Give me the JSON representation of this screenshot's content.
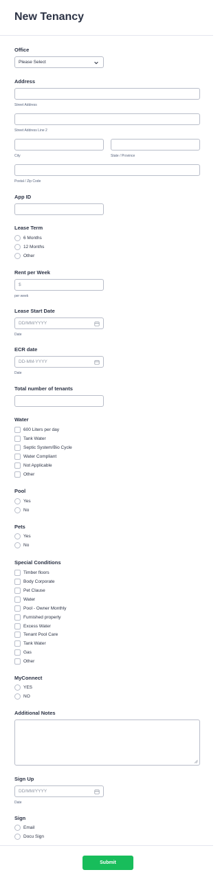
{
  "header": {
    "title": "New Tenancy"
  },
  "office": {
    "label": "Office",
    "selected": "Please Select"
  },
  "address": {
    "label": "Address",
    "street_sub": "Street Address",
    "street2_sub": "Street Address Line 2",
    "city_sub": "City",
    "state_sub": "State / Province",
    "postal_sub": "Postal / Zip Code"
  },
  "app_id": {
    "label": "App ID"
  },
  "lease_term": {
    "label": "Lease Term",
    "options": [
      "6 Months",
      "12 Months",
      "Other"
    ]
  },
  "rent": {
    "label": "Rent per Week",
    "prefix": "$",
    "sub": "per week"
  },
  "lease_start": {
    "label": "Lease Start Date",
    "placeholder": "DD/MM/YYYY",
    "sub": "Date"
  },
  "ecr": {
    "label": "ECR date",
    "placeholder": "DD-MM-YYYY",
    "sub": "Date"
  },
  "tenants": {
    "label": "Total number of tenants"
  },
  "water": {
    "label": "Water",
    "options": [
      "600 Liters per day",
      "Tank Water",
      "Septic System/Bio Cycle",
      "Water Compliant",
      "Not Applicable",
      "Other"
    ]
  },
  "pool": {
    "label": "Pool",
    "options": [
      "Yes",
      "No"
    ]
  },
  "pets": {
    "label": "Pets",
    "options": [
      "Yes",
      "No"
    ]
  },
  "special": {
    "label": "Special Conditions",
    "options": [
      "Timber floors",
      "Body Corporate",
      "Pet Clause",
      "Water",
      "Pool - Owner Monthly",
      "Furnished property",
      "Excess Water",
      "Tenant Pool Care",
      "Tank Water",
      "Gas",
      "Other"
    ]
  },
  "myconnect": {
    "label": "MyConnect",
    "options": [
      "YES",
      "NO"
    ]
  },
  "notes": {
    "label": "Additional Notes"
  },
  "signup": {
    "label": "Sign Up",
    "placeholder": "DD/MM/YYYY",
    "sub": "Date"
  },
  "sign": {
    "label": "Sign",
    "options": [
      "Email",
      "Docu Sign"
    ]
  },
  "footer": {
    "submit_label": "Submit"
  },
  "colors": {
    "submit": "#18bd5b",
    "text": "#2c3345",
    "border": "#b8bdc9"
  },
  "icons": {
    "dropdown": "chevron-down-icon",
    "date": "calendar-icon"
  }
}
